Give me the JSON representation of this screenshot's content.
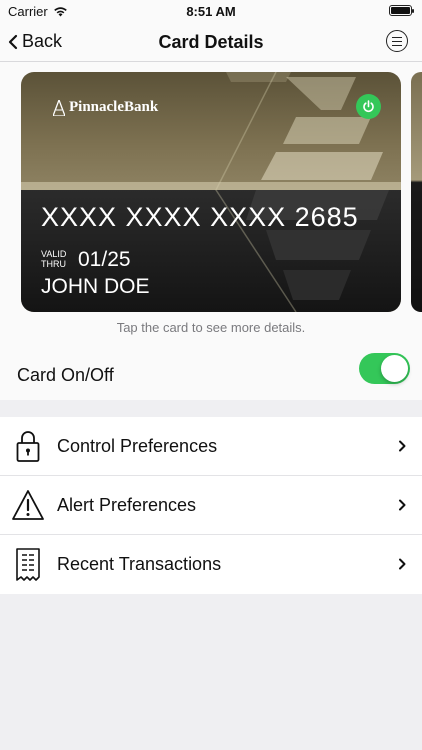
{
  "status_bar": {
    "carrier": "Carrier",
    "time": "8:51 AM"
  },
  "nav": {
    "back_label": "Back",
    "title": "Card Details"
  },
  "card": {
    "bank_name": "PinnacleBank",
    "number": "XXXX XXXX XXXX 2685",
    "valid_label_line1": "VALID",
    "valid_label_line2": "THRU",
    "valid_date": "01/25",
    "holder": "JOHN DOE",
    "power_state": "on"
  },
  "hint": "Tap the card to see more details.",
  "card_toggle": {
    "label": "Card On/Off",
    "state": "on"
  },
  "menu": [
    {
      "label": "Control Preferences",
      "icon": "padlock-icon"
    },
    {
      "label": "Alert Preferences",
      "icon": "warning-triangle-icon"
    },
    {
      "label": "Recent Transactions",
      "icon": "receipt-icon"
    }
  ],
  "colors": {
    "toggle_on": "#34c759",
    "background": "#efeff2"
  }
}
